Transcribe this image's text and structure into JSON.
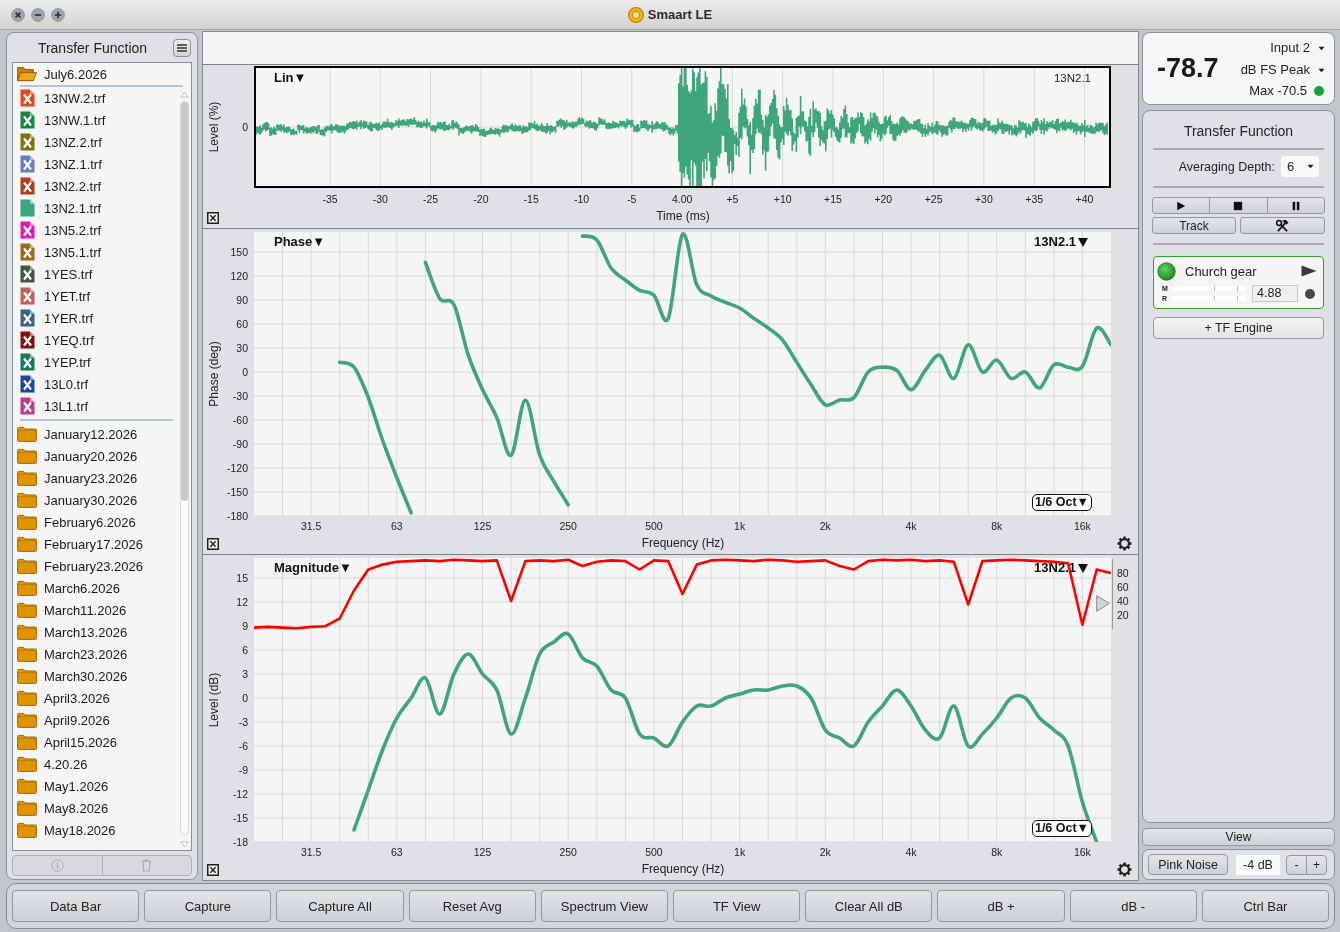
{
  "window": {
    "title": "Smaart LE"
  },
  "sidebar": {
    "title": "Transfer Function",
    "tree": [
      {
        "kind": "folder",
        "label": "July6.2026",
        "expanded": true,
        "children": [
          {
            "kind": "file",
            "label": "13NW.2.trf",
            "color": "#e5481e",
            "shown": false
          },
          {
            "kind": "file",
            "label": "13NW.1.trf",
            "color": "#138a3e",
            "shown": false
          },
          {
            "kind": "file",
            "label": "13NZ.2.trf",
            "color": "#7b7412",
            "shown": false
          },
          {
            "kind": "file",
            "label": "13NZ.1.trf",
            "color": "#6a7cbc",
            "shown": false
          },
          {
            "kind": "file",
            "label": "13N2.2.trf",
            "color": "#b5391a",
            "shown": false
          },
          {
            "kind": "file",
            "label": "13N2.1.trf",
            "color": "#3fa57c",
            "shown": true
          },
          {
            "kind": "file",
            "label": "13N5.2.trf",
            "color": "#e01cb4",
            "shown": false
          },
          {
            "kind": "file",
            "label": "13N5.1.trf",
            "color": "#9a6c18",
            "shown": false
          },
          {
            "kind": "file",
            "label": "1YES.trf",
            "color": "#3e5a3c",
            "shown": false
          },
          {
            "kind": "file",
            "label": "1YET.trf",
            "color": "#c06060",
            "shown": false
          },
          {
            "kind": "file",
            "label": "1YER.trf",
            "color": "#36658a",
            "shown": false
          },
          {
            "kind": "file",
            "label": "1YEQ.trf",
            "color": "#861010",
            "shown": false
          },
          {
            "kind": "file",
            "label": "1YEP.trf",
            "color": "#0e7c5c",
            "shown": false
          },
          {
            "kind": "file",
            "label": "13L0.trf",
            "color": "#1848a0",
            "shown": false
          },
          {
            "kind": "file",
            "label": "13L1.trf",
            "color": "#c03c88",
            "shown": false
          }
        ]
      },
      {
        "kind": "folder",
        "label": "January12.2026",
        "expanded": false
      },
      {
        "kind": "folder",
        "label": "January20.2026",
        "expanded": false
      },
      {
        "kind": "folder",
        "label": "January23.2026",
        "expanded": false
      },
      {
        "kind": "folder",
        "label": "January30.2026",
        "expanded": false
      },
      {
        "kind": "folder",
        "label": "February6.2026",
        "expanded": false
      },
      {
        "kind": "folder",
        "label": "February17.2026",
        "expanded": false
      },
      {
        "kind": "folder",
        "label": "February23.2026",
        "expanded": false
      },
      {
        "kind": "folder",
        "label": "March6.2026",
        "expanded": false
      },
      {
        "kind": "folder",
        "label": "March11.2026",
        "expanded": false
      },
      {
        "kind": "folder",
        "label": "March13.2026",
        "expanded": false
      },
      {
        "kind": "folder",
        "label": "March23.2026",
        "expanded": false
      },
      {
        "kind": "folder",
        "label": "March30.2026",
        "expanded": false
      },
      {
        "kind": "folder",
        "label": "April3.2026",
        "expanded": false
      },
      {
        "kind": "folder",
        "label": "April9.2026",
        "expanded": false
      },
      {
        "kind": "folder",
        "label": "April15.2026",
        "expanded": false
      },
      {
        "kind": "folder",
        "label": "4.20.26",
        "expanded": false
      },
      {
        "kind": "folder",
        "label": "May1.2026",
        "expanded": false
      },
      {
        "kind": "folder",
        "label": "May8.2026",
        "expanded": false
      },
      {
        "kind": "folder",
        "label": "May18.2026",
        "expanded": false
      }
    ],
    "actions": [
      {
        "kind": "info",
        "disabled": true
      },
      {
        "kind": "delete",
        "disabled": true
      }
    ]
  },
  "impulse_panel": {
    "mode_label": "Lin▼",
    "trace_label": "13N2.1",
    "ylabel": "Level (%)",
    "y_ticks": [
      "0"
    ],
    "x_ticks": [
      "-35",
      "-30",
      "-25",
      "-20",
      "-15",
      "-10",
      "-5",
      "4.00",
      "+5",
      "+10",
      "+15",
      "+20",
      "+25",
      "+30",
      "+35",
      "+40"
    ],
    "xlabel": "Time (ms)"
  },
  "phase_panel": {
    "mode_label": "Phase▼",
    "smoothing": "1/6 Oct▼",
    "chart_data": {
      "type": "line",
      "xlabel": "Frequency (Hz)",
      "ylabel": "Phase (deg)",
      "categories": [
        null,
        null,
        null,
        null,
        "31.5",
        null,
        null,
        null,
        null,
        null,
        "63",
        null,
        null,
        null,
        null,
        null,
        "125",
        null,
        null,
        null,
        null,
        null,
        "250",
        null,
        null,
        null,
        null,
        null,
        "500",
        null,
        null,
        null,
        null,
        null,
        "1k",
        null,
        null,
        null,
        null,
        null,
        "2k",
        null,
        null,
        null,
        null,
        null,
        "4k",
        null,
        null,
        null,
        null,
        null,
        "8k",
        null,
        null,
        null,
        null,
        null,
        "16k",
        null,
        null
      ],
      "series": [
        {
          "name": "13N2.1",
          "color": "#3fa57c",
          "values": [
            null,
            null,
            null,
            null,
            null,
            null,
            12,
            6,
            -32,
            -85,
            -132,
            -176,
            137,
            92,
            84,
            21,
            -22,
            -57,
            -104,
            -35,
            -104,
            -137,
            -166,
            170,
            165,
            130,
            115,
            102,
            96,
            67,
            172,
            109,
            95,
            87,
            80,
            67,
            55,
            40,
            12,
            -16,
            -41,
            -35,
            -32,
            0,
            6,
            2,
            -22,
            2,
            21,
            -8,
            34,
            0,
            15,
            -8,
            0,
            -20,
            9,
            6,
            7,
            55,
            34
          ]
        }
      ],
      "ylim": [
        -180,
        175
      ],
      "yticks": [
        150,
        120,
        90,
        60,
        30,
        0,
        -30,
        -60,
        -90,
        -120,
        -150,
        -180
      ],
      "grid": true
    }
  },
  "magnitude_panel": {
    "mode_label": "Magnitude▼",
    "smoothing": "1/6 Oct▼",
    "chart_data": {
      "type": "line",
      "xlabel": "Frequency (Hz)",
      "ylabel": "Level (dB)",
      "categories": [
        null,
        null,
        null,
        null,
        "31.5",
        null,
        null,
        null,
        null,
        null,
        "63",
        null,
        null,
        null,
        null,
        null,
        "125",
        null,
        null,
        null,
        null,
        null,
        "250",
        null,
        null,
        null,
        null,
        null,
        "500",
        null,
        null,
        null,
        null,
        null,
        "1k",
        null,
        null,
        null,
        null,
        null,
        "2k",
        null,
        null,
        null,
        null,
        null,
        "4k",
        null,
        null,
        null,
        null,
        null,
        "8k",
        null,
        null,
        null,
        null,
        null,
        "16k",
        null,
        null
      ],
      "series": [
        {
          "name": "13N2.1",
          "color": "#3fa57c",
          "values": [
            null,
            null,
            null,
            null,
            null,
            null,
            null,
            -16.5,
            -11.5,
            -6.5,
            -2.5,
            0,
            2.5,
            -2,
            3,
            5.5,
            3,
            1,
            -4.5,
            0,
            5.5,
            7,
            8,
            5,
            4,
            1,
            0,
            -4.5,
            -5,
            -6,
            -3,
            -1,
            -1,
            0,
            0.5,
            1,
            1,
            1.5,
            1.5,
            0,
            -4,
            -5,
            -6,
            -3,
            -1,
            1,
            -1,
            -4,
            -5,
            -1,
            -6,
            -4.5,
            -2.5,
            0,
            0,
            -2.5,
            -4,
            -6,
            -13,
            -18,
            null
          ]
        }
      ],
      "ylim": [
        -18,
        17.5
      ],
      "yticks": [
        15,
        12,
        9,
        6,
        3,
        0,
        -3,
        -6,
        -9,
        -12,
        -15,
        -18
      ],
      "grid": true
    },
    "coherence": {
      "chart_data": {
        "type": "line",
        "categories": [
          null,
          null,
          null,
          null,
          null,
          null,
          null,
          null,
          null,
          null,
          null,
          null,
          null,
          null,
          null,
          null,
          null,
          null,
          null,
          null,
          null,
          null,
          null,
          null,
          null,
          null,
          null,
          null,
          null,
          null,
          null,
          null,
          null,
          null,
          null,
          null,
          null,
          null,
          null,
          null,
          null,
          null,
          null,
          null,
          null,
          null,
          null,
          null,
          null,
          null,
          null,
          null,
          null,
          null,
          null,
          null,
          null,
          null,
          null,
          null,
          null
        ],
        "series": [
          {
            "color": "#ff0000",
            "values": [
              2,
              3,
              2,
              1,
              3,
              4,
              15,
              55,
              85,
              92,
              96,
              97,
              98,
              97,
              99,
              98,
              97,
              98,
              40,
              97,
              98,
              97,
              99,
              90,
              96,
              98,
              97,
              85,
              98,
              97,
              50,
              92,
              98,
              99,
              98,
              97,
              99,
              98,
              96,
              97,
              98,
              90,
              85,
              97,
              99,
              98,
              99,
              97,
              98,
              96,
              35,
              97,
              98,
              99,
              98,
              97,
              96,
              94,
              6,
              85,
              80
            ]
          }
        ],
        "ylim": [
          0,
          100
        ],
        "yticks": [
          80,
          60,
          40,
          20
        ]
      }
    }
  },
  "meter": {
    "reading": "-78.7",
    "input": "Input 2",
    "scale": "dB FS Peak",
    "max": "Max -70.5"
  },
  "control_panel": {
    "title": "Transfer Function",
    "averaging_label": "Averaging Depth:",
    "averaging_value": "6",
    "track_button": "Track",
    "engine": {
      "name": "Church gear",
      "running": true,
      "delay": "4.88",
      "meters": [
        {
          "label": "M"
        },
        {
          "label": "R"
        }
      ]
    },
    "add_engine_button": "+ TF Engine"
  },
  "view_button": "View",
  "generator": {
    "button": "Pink Noise",
    "level": "-4 dB",
    "decrease": "-",
    "increase": "+"
  },
  "bottom_bar": {
    "buttons": [
      "Data Bar",
      "Capture",
      "Capture All",
      "Reset Avg",
      "Spectrum View",
      "TF View",
      "Clear All dB",
      "dB +",
      "dB -",
      "Ctrl Bar"
    ]
  }
}
